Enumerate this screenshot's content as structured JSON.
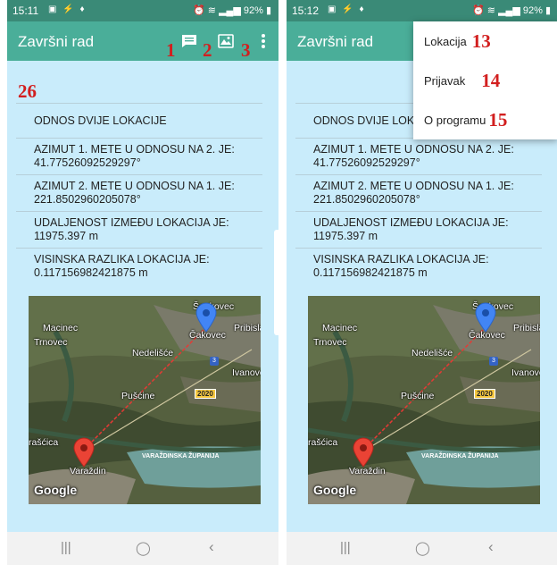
{
  "screens": [
    {
      "status": {
        "time": "15:11",
        "battery": "92%"
      },
      "app_title": "Završni rad",
      "annotations": {
        "chat": "1",
        "map": "2",
        "more": "3",
        "content": "26"
      },
      "list": [
        "ODNOS DVIJE LOKACIJE",
        "AZIMUT 1. METE U ODNOSU NA 2. JE: 41.77526092529297°",
        "AZIMUT 2. METE U ODNOSU NA 1. JE: 221.8502960205078°",
        "UDALJENOST IZMEĐU LOKACIJA JE: 11975.397 m",
        "VISINSKA RAZLIKA LOKACIJA JE: 0.117156982421875 m"
      ]
    },
    {
      "status": {
        "time": "15:12",
        "battery": "92%"
      },
      "app_title": "Završni rad",
      "list": [
        "ODNOS DVIJE LOKACIJE",
        "AZIMUT 1. METE U ODNOSU NA 2. JE: 41.77526092529297°",
        "AZIMUT 2. METE U ODNOSU NA 1. JE: 221.8502960205078°",
        "UDALJENOST IZMEĐU LOKACIJA JE: 11975.397 m",
        "VISINSKA RAZLIKA LOKACIJA JE: 0.117156982421875 m"
      ],
      "menu": [
        {
          "label": "Lokacija",
          "annotation": "13"
        },
        {
          "label": "Prijavak",
          "annotation": "14"
        },
        {
          "label": "O programu",
          "annotation": "15"
        }
      ]
    }
  ],
  "map": {
    "places": {
      "senkovec": "Šenkovec",
      "macinec": "Macinec",
      "trnovec": "Trnovec",
      "nedelisce": "Nedelišće",
      "cakovec": "Čakovec",
      "pribislavec": "Pribisla",
      "ivanovec": "Ivanove",
      "puscine": "Pušćine",
      "rascica": "rašćica",
      "varazdin": "Varaždin"
    },
    "road_badge": "2020",
    "road_shield": "3",
    "region_label": "VARAŽDINSKA ŽUPANIJA",
    "logo": "Google"
  },
  "colors": {
    "status_bar": "#3a8a77",
    "app_bar": "#4aae99",
    "content_bg": "#c9ecfb",
    "annotation": "#d21f1f",
    "marker_blue": "#4285f4",
    "marker_red": "#ea4335",
    "distance_line": "#e53935"
  },
  "icons": [
    "chat-icon",
    "map-icon",
    "more-vert-icon",
    "recents-icon",
    "home-icon",
    "back-icon"
  ]
}
